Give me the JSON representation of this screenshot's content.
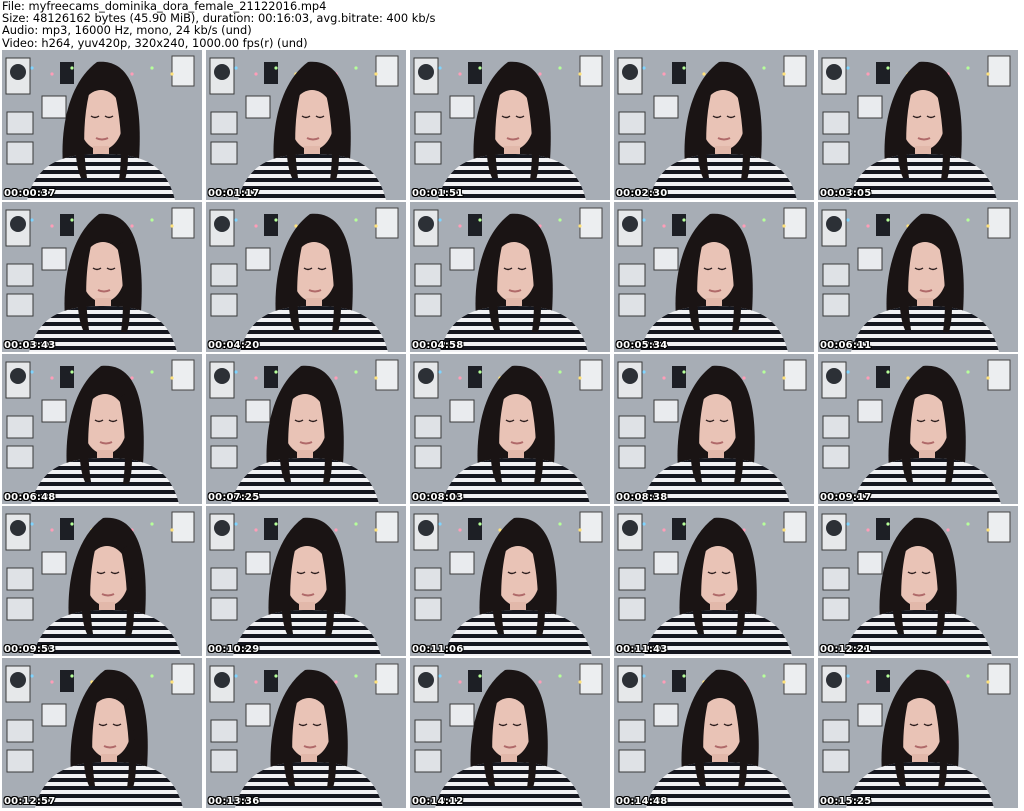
{
  "header": {
    "file": "File: myfreecams_dominika_dora_female_21122016.mp4",
    "size": "Size: 48126162 bytes (45.90 MiB), duration: 00:16:03, avg.bitrate: 400 kb/s",
    "audio": "Audio: mp3, 16000 Hz, mono, 24 kb/s (und)",
    "video": "Video: h264, yuv420p, 320x240, 1000.00 fps(r) (und)"
  },
  "thumbnails": [
    {
      "timestamp": "00:00:37"
    },
    {
      "timestamp": "00:01:17"
    },
    {
      "timestamp": "00:01:51"
    },
    {
      "timestamp": "00:02:30"
    },
    {
      "timestamp": "00:03:05"
    },
    {
      "timestamp": "00:03:43"
    },
    {
      "timestamp": "00:04:20"
    },
    {
      "timestamp": "00:04:58"
    },
    {
      "timestamp": "00:05:34"
    },
    {
      "timestamp": "00:06:11"
    },
    {
      "timestamp": "00:06:48"
    },
    {
      "timestamp": "00:07:25"
    },
    {
      "timestamp": "00:08:03"
    },
    {
      "timestamp": "00:08:38"
    },
    {
      "timestamp": "00:09:17"
    },
    {
      "timestamp": "00:09:53"
    },
    {
      "timestamp": "00:10:29"
    },
    {
      "timestamp": "00:11:06"
    },
    {
      "timestamp": "00:11:43"
    },
    {
      "timestamp": "00:12:21"
    },
    {
      "timestamp": "00:12:57"
    },
    {
      "timestamp": "00:13:36"
    },
    {
      "timestamp": "00:14:12"
    },
    {
      "timestamp": "00:14:48"
    },
    {
      "timestamp": "00:15:25"
    }
  ],
  "colors": {
    "wall": "#a7adb5",
    "hair": "#1a1414",
    "skin": "#e9c3b6",
    "stripe_dark": "#15171f",
    "stripe_light": "#f1f1f3"
  }
}
